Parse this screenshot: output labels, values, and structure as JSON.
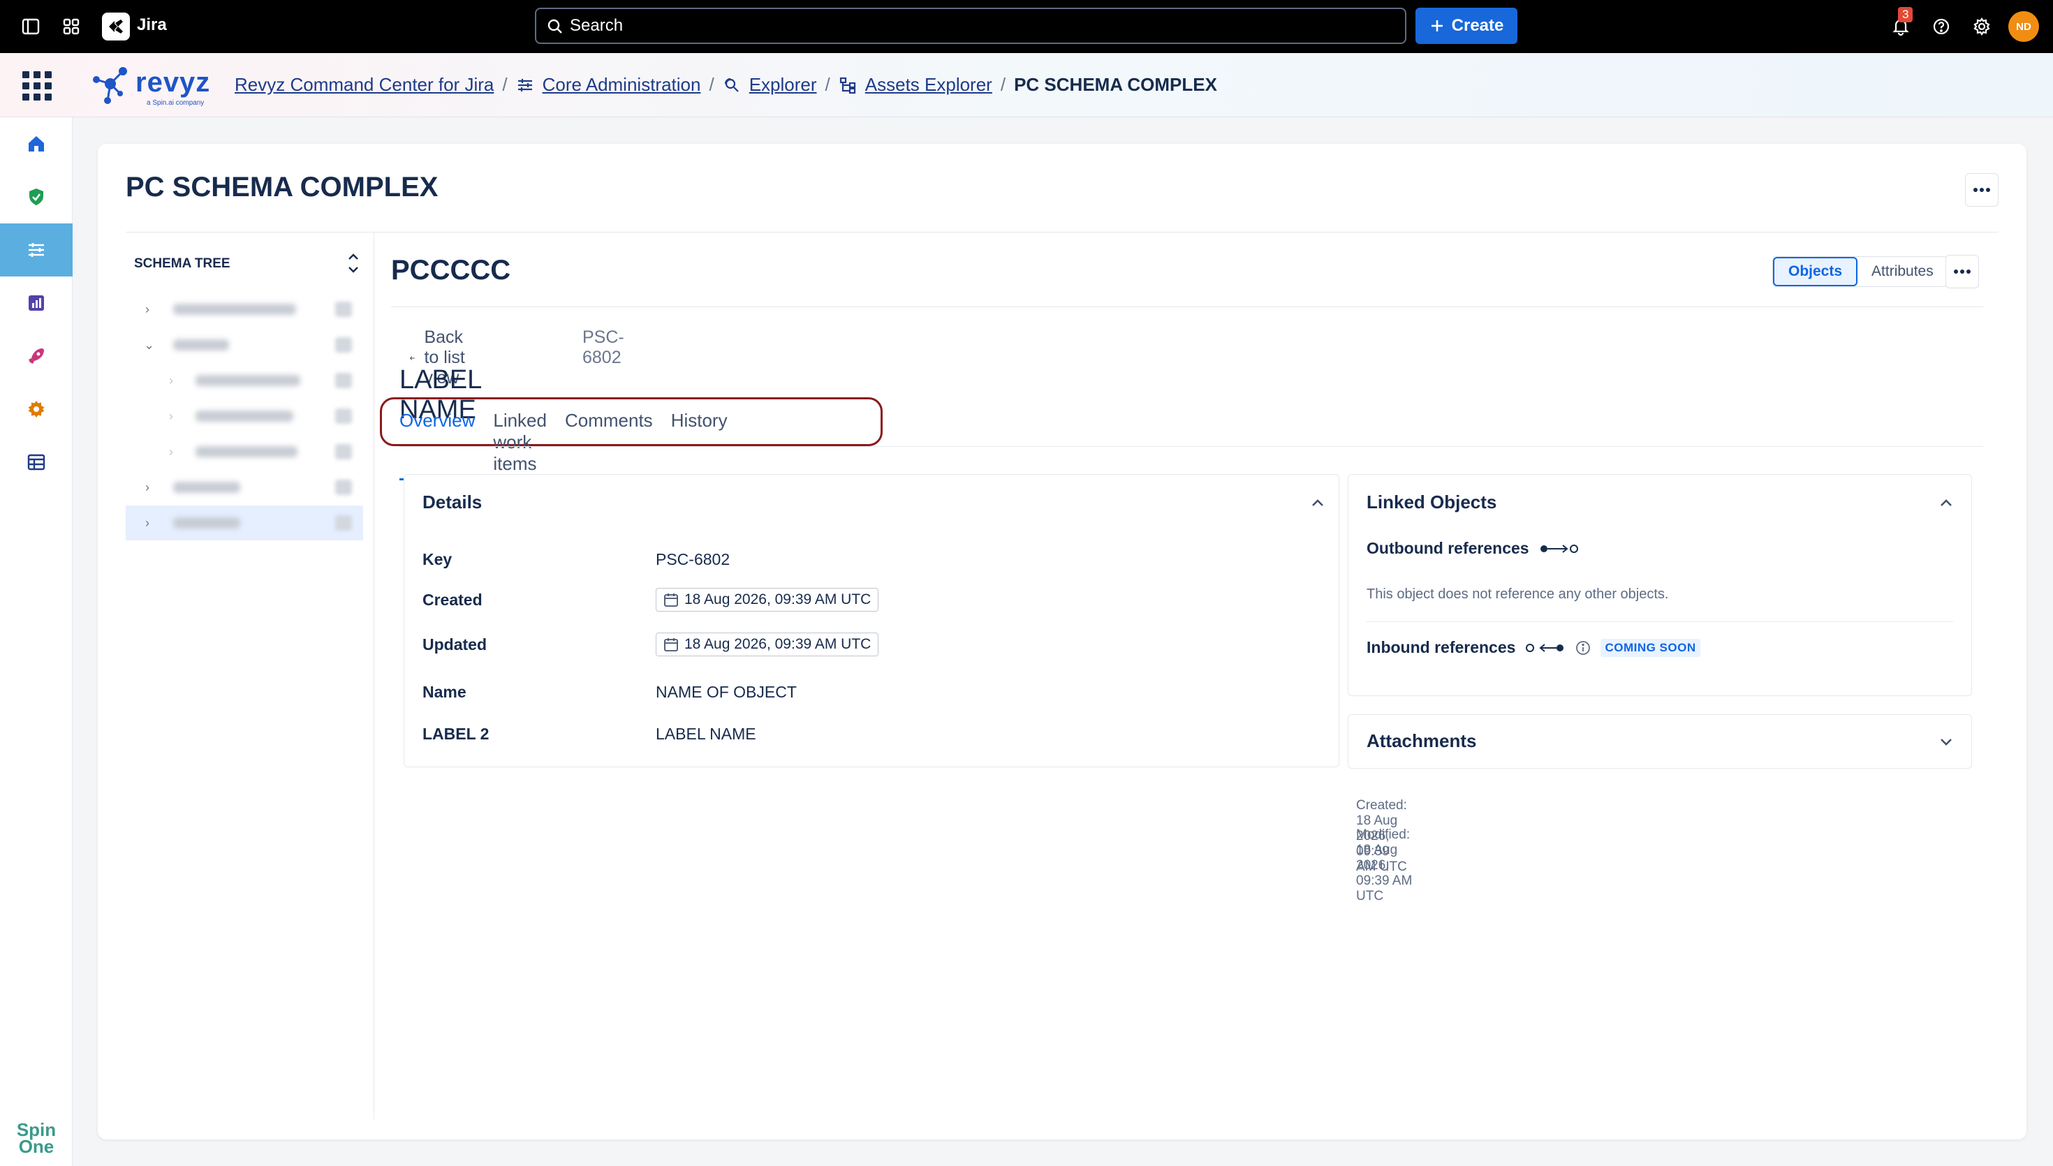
{
  "topbar": {
    "product": "Jira",
    "search_placeholder": "Search",
    "create_label": "Create",
    "notification_count": "3",
    "avatar_initials": "ND"
  },
  "header": {
    "breadcrumb": [
      {
        "label": "Revyz Command Center for Jira"
      },
      {
        "label": "Core Administration"
      },
      {
        "label": "Explorer"
      },
      {
        "label": "Assets Explorer"
      }
    ],
    "current": "PC SCHEMA COMPLEX",
    "logo_text": "revyz",
    "logo_sub": "a Spin.ai company"
  },
  "rail": {
    "footer_logo_line1": "Spin",
    "footer_logo_line2": "One"
  },
  "page": {
    "title": "PC SCHEMA COMPLEX"
  },
  "tree": {
    "title": "SCHEMA TREE"
  },
  "object": {
    "title": "PCCCCC",
    "view_objects": "Objects",
    "view_attributes": "Attributes",
    "back_label": "Back to list view",
    "key": "PSC-6802",
    "label_name": "LABEL NAME",
    "tabs": [
      {
        "label": "Overview"
      },
      {
        "label": "Linked work items"
      },
      {
        "label": "Comments"
      },
      {
        "label": "History"
      }
    ]
  },
  "details": {
    "title": "Details",
    "rows": [
      {
        "label": "Key",
        "value": "PSC-6802"
      },
      {
        "label": "Created",
        "value": "18 Aug 2026, 09:39 AM UTC"
      },
      {
        "label": "Updated",
        "value": "18 Aug 2026, 09:39 AM UTC"
      },
      {
        "label": "Name",
        "value": "NAME OF OBJECT"
      },
      {
        "label": "LABEL 2",
        "value": "LABEL NAME"
      }
    ]
  },
  "linked": {
    "title": "Linked Objects",
    "outbound_label": "Outbound references",
    "outbound_note": "This object does not reference any other objects.",
    "inbound_label": "Inbound references",
    "coming_soon": "COMING SOON"
  },
  "attachments": {
    "title": "Attachments"
  },
  "meta": {
    "created_label": "Created:",
    "created_value": "18 Aug 2026, 09:39 AM UTC",
    "modified_label": "Modified:",
    "modified_value": "18 Aug 2026, 09:39 AM UTC"
  }
}
